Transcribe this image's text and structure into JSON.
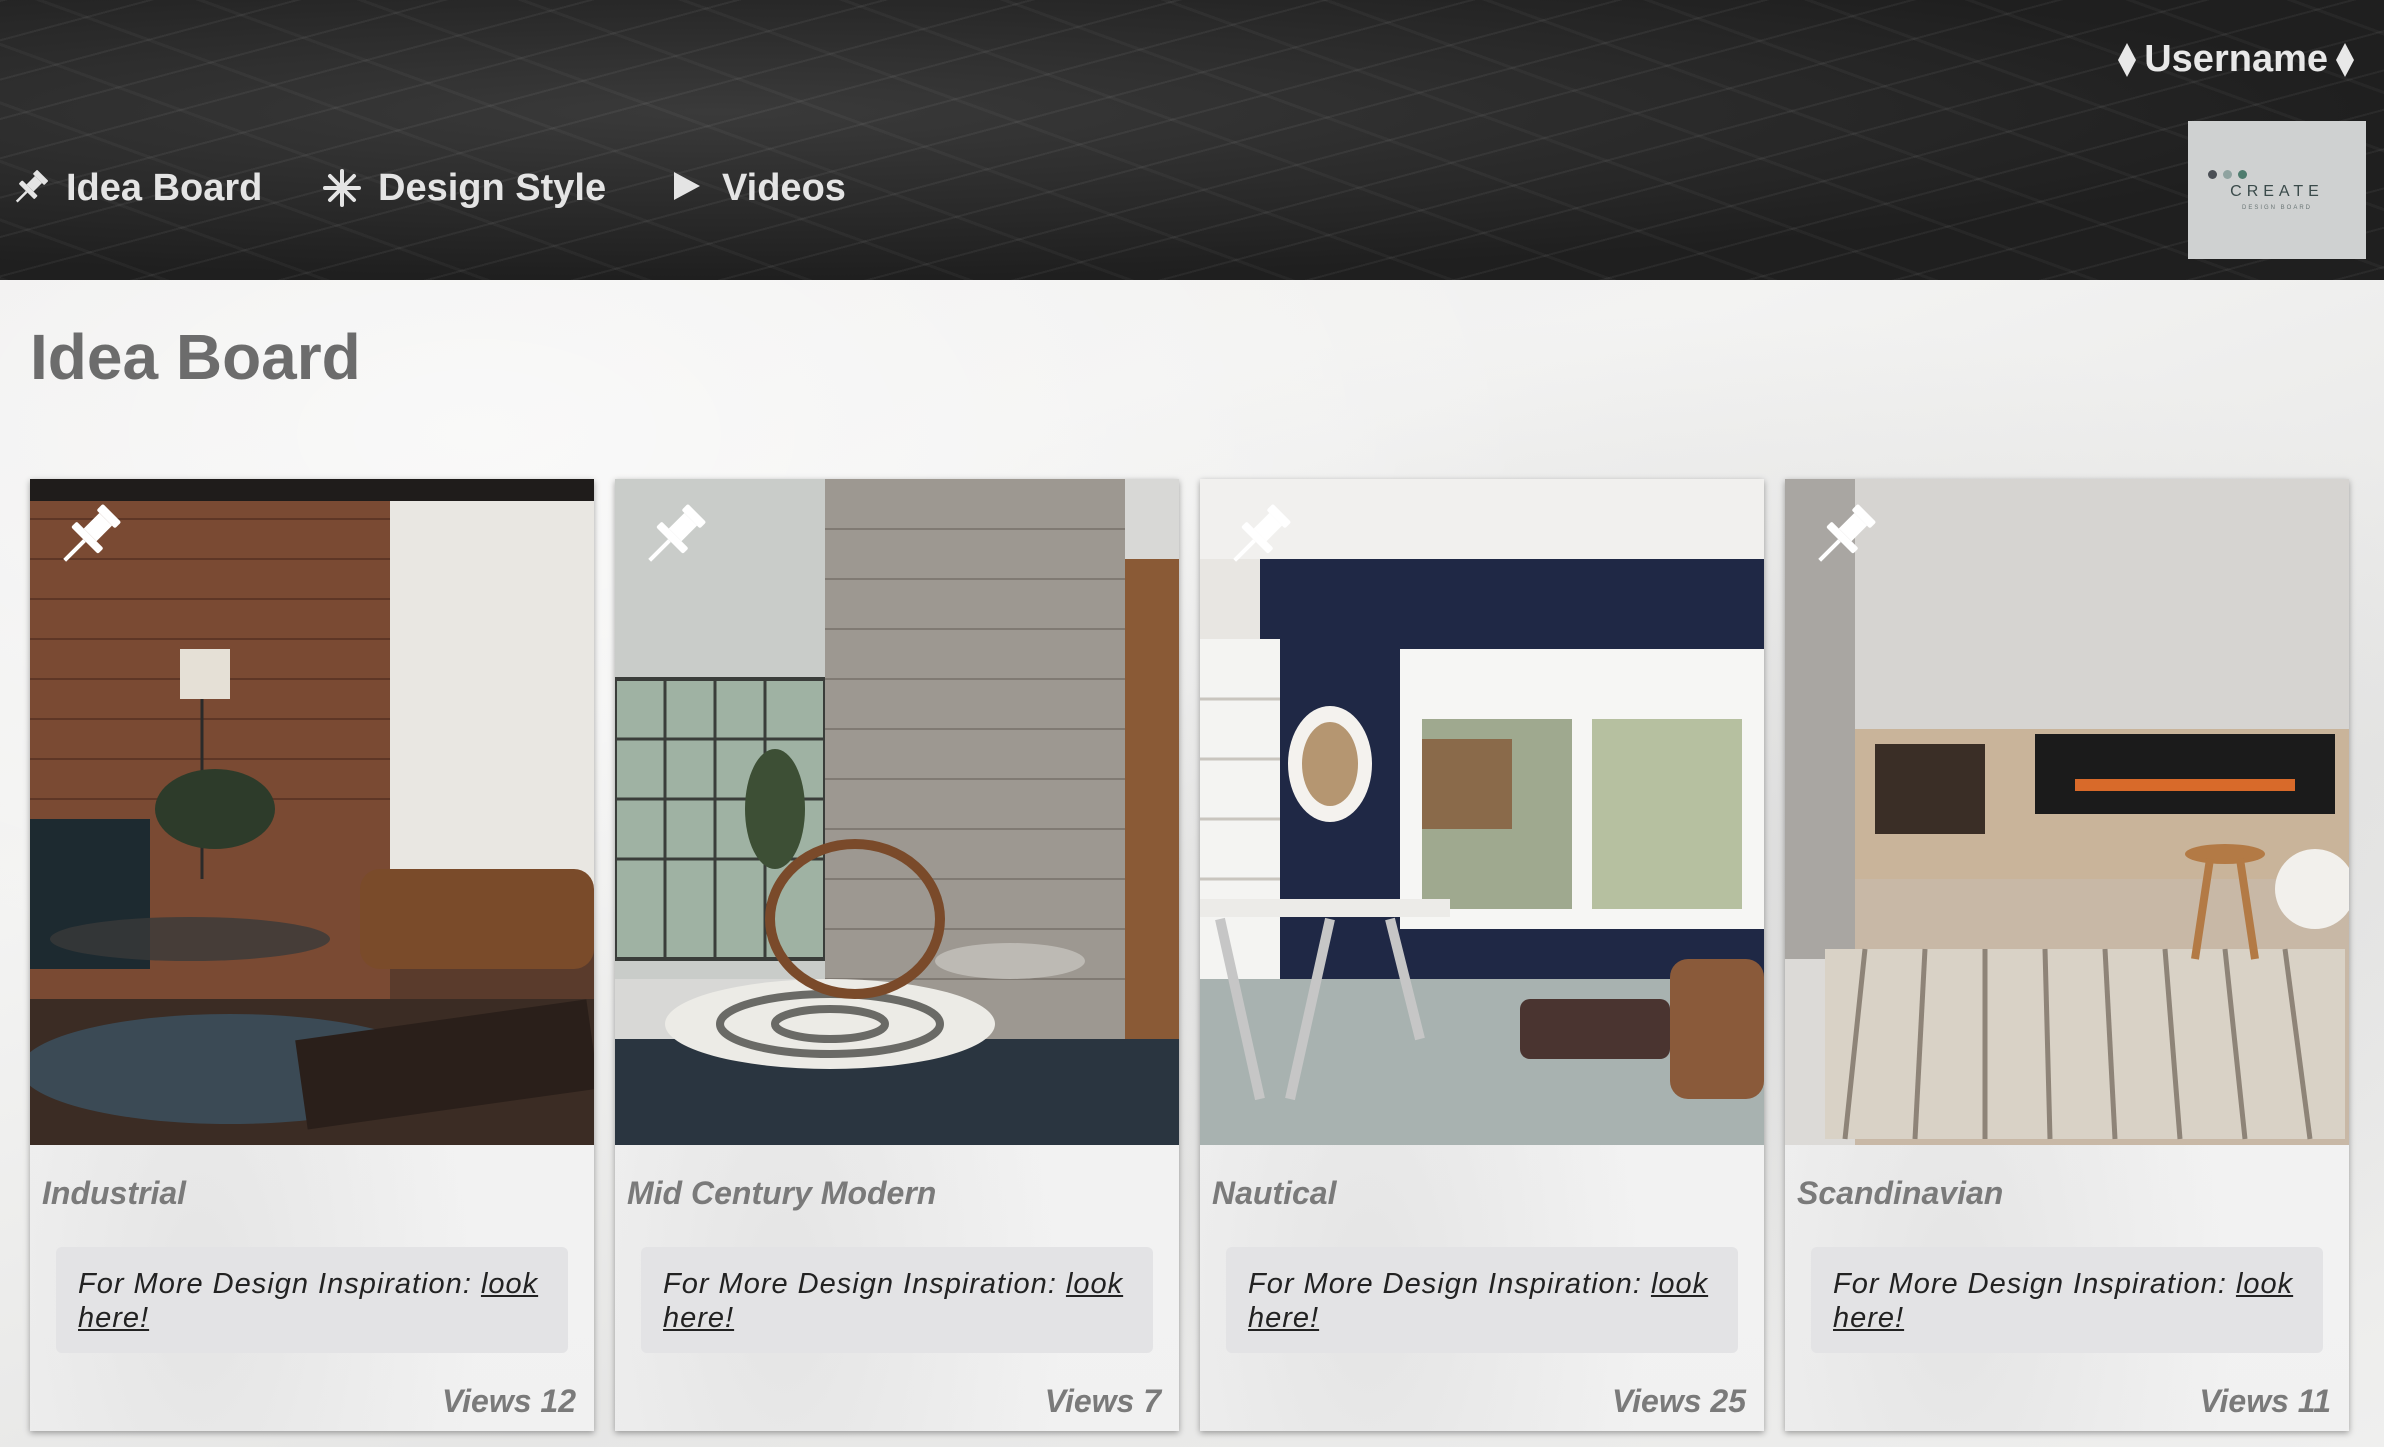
{
  "nav": {
    "items": [
      {
        "label": "Idea Board",
        "icon": "pushpin-icon"
      },
      {
        "label": "Design Style",
        "icon": "asterisk-icon"
      },
      {
        "label": "Videos",
        "icon": "play-icon"
      }
    ]
  },
  "user": {
    "name": "Username"
  },
  "logo": {
    "word": "CREATE",
    "sub": "DESIGN BOARD",
    "colors": [
      "#4b4f55",
      "#8fa3a0",
      "#4f7c6e"
    ]
  },
  "page": {
    "title": "Idea Board"
  },
  "cards": [
    {
      "title": "Industrial",
      "prompt": "For More Design Inspiration: ",
      "link": "look here!",
      "views": "Views 12"
    },
    {
      "title": "Mid Century Modern",
      "prompt": "For More Design Inspiration: ",
      "link": "look here!",
      "views": "Views 7"
    },
    {
      "title": "Nautical",
      "prompt": "For More Design Inspiration: ",
      "link": "look here!",
      "views": "Views 25"
    },
    {
      "title": "Scandinavian",
      "prompt": "For More Design Inspiration: ",
      "link": "look here!",
      "views": "Views 11"
    }
  ],
  "colors": {
    "header_bg": "#262626",
    "nav_text": "#e4e4e4",
    "title_text": "#6c6c6c",
    "inspo_bg": "#e3e3e5"
  }
}
